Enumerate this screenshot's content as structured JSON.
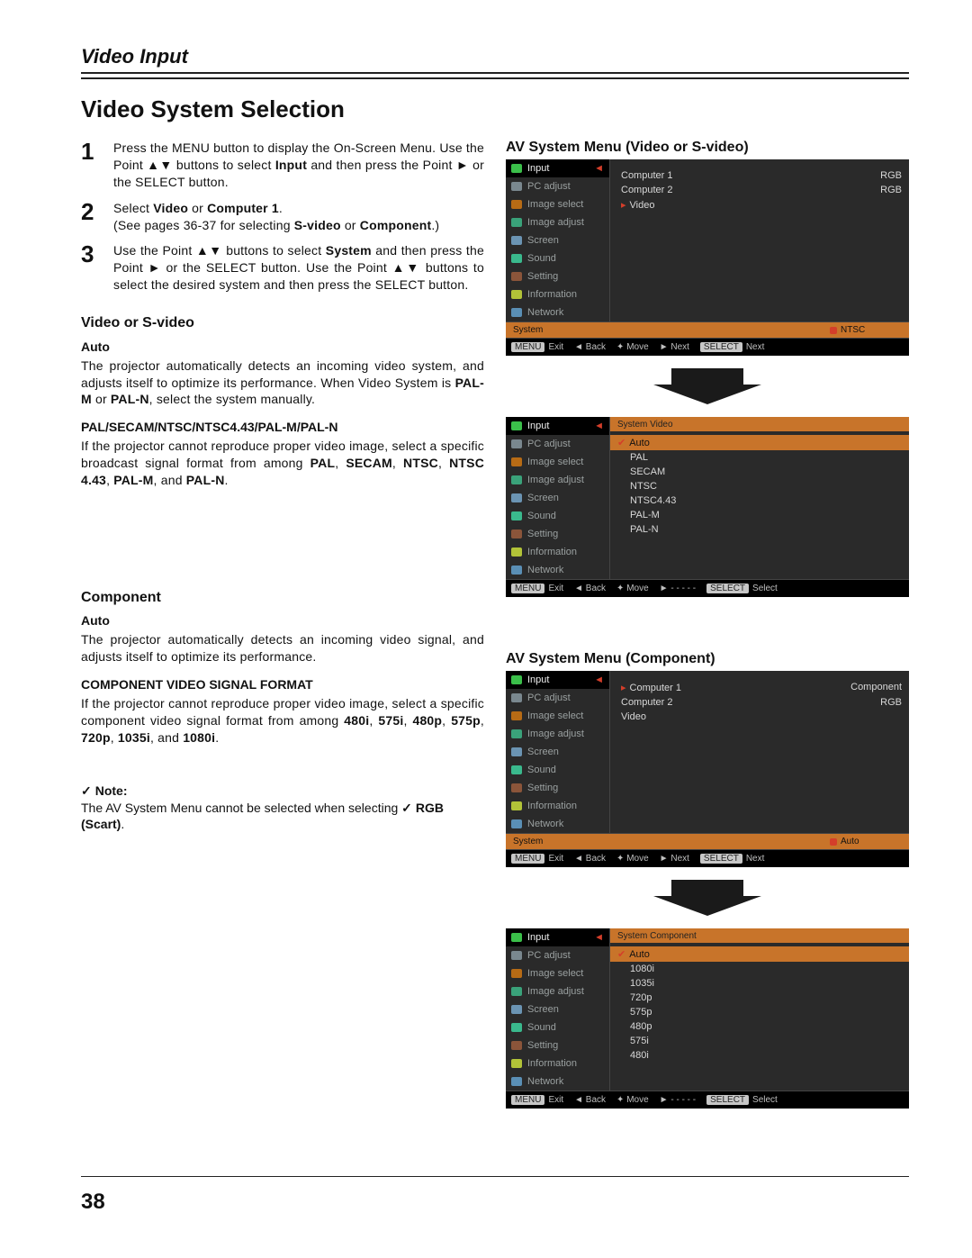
{
  "kicker": "Video Input",
  "title": "Video System Selection",
  "steps": [
    {
      "n": "1",
      "html": "Press the MENU button to display the On-Screen Menu. Use the Point ▲▼ buttons to select <b>Input</b> and then press the Point ► or the SELECT button."
    },
    {
      "n": "2",
      "html": "Select <b>Video</b> or <b>Computer 1</b>.<br>(See pages 36-37 for selecting <b>S-video</b> or <b>Component</b>.)"
    },
    {
      "n": "3",
      "html": "Use the Point ▲▼ buttons to select <b>System</b> and then press the Point ► or the SELECT button. Use the Point ▲▼ buttons to select the desired system and then press the SELECT button."
    }
  ],
  "left": {
    "svideo": {
      "heading": "Video or S-video",
      "auto_h": "Auto",
      "auto": "The projector automatically detects an incoming video system, and adjusts itself to optimize its performance. When Video System is <b>PAL-M</b> or <b>PAL-N</b>, select the system manually.",
      "fmt_h": "PAL/SECAM/NTSC/NTSC4.43/PAL-M/PAL-N",
      "fmt": "If the projector cannot reproduce proper video image, select a specific broadcast signal format from among <b>PAL</b>, <b>SECAM</b>, <b>NTSC</b>, <b>NTSC 4.43</b>, <b>PAL-M</b>, and <b>PAL-N</b>."
    },
    "component": {
      "heading": "Component",
      "auto_h": "Auto",
      "auto": "The projector automatically detects an incoming video signal, and adjusts itself to optimize its performance.",
      "fmt_h": "COMPONENT VIDEO SIGNAL FORMAT",
      "fmt": "If the projector cannot reproduce proper video image, select a specific component video signal format from among <b>480i</b>, <b>575i</b>, <b>480p</b>, <b>575p</b>, <b>720p</b>, <b>1035i</b>, and <b>1080i</b>."
    },
    "note_h": "Note:",
    "note": "The AV System Menu cannot be selected when selecting <b>RGB (Scart)</b>."
  },
  "right": {
    "cap1": "AV System Menu (Video or S-video)",
    "cap2": "AV System Menu (Component)"
  },
  "side_items": [
    "Input",
    "PC adjust",
    "Image select",
    "Image adjust",
    "Screen",
    "Sound",
    "Setting",
    "Information",
    "Network"
  ],
  "osd1_inputs": [
    [
      "Computer 1",
      "RGB"
    ],
    [
      "Computer 2",
      "RGB"
    ],
    [
      "Video",
      ""
    ]
  ],
  "osd1_systembar": {
    "label": "System",
    "value": "NTSC"
  },
  "foot_main": [
    "MENU Exit",
    "◄ Back",
    "✦ Move",
    "► Next",
    "SELECT Next"
  ],
  "foot_sub": [
    "MENU Exit",
    "◄ Back",
    "✦ Move",
    "► - - - - -",
    "SELECT Select"
  ],
  "osd2_header": "System  Video",
  "osd2_list": [
    "Auto",
    "PAL",
    "SECAM",
    "NTSC",
    "NTSC4.43",
    "PAL-M",
    "PAL-N"
  ],
  "osd3_inputs": [
    [
      "Computer 1",
      "Component"
    ],
    [
      "Computer 2",
      "RGB"
    ],
    [
      "Video",
      ""
    ]
  ],
  "osd3_systembar": {
    "label": "System",
    "value": "Auto"
  },
  "osd4_header": "System  Component",
  "osd4_list": [
    "Auto",
    "1080i",
    "1035i",
    "720p",
    "575p",
    "480p",
    "575i",
    "480i"
  ],
  "page_number": "38"
}
